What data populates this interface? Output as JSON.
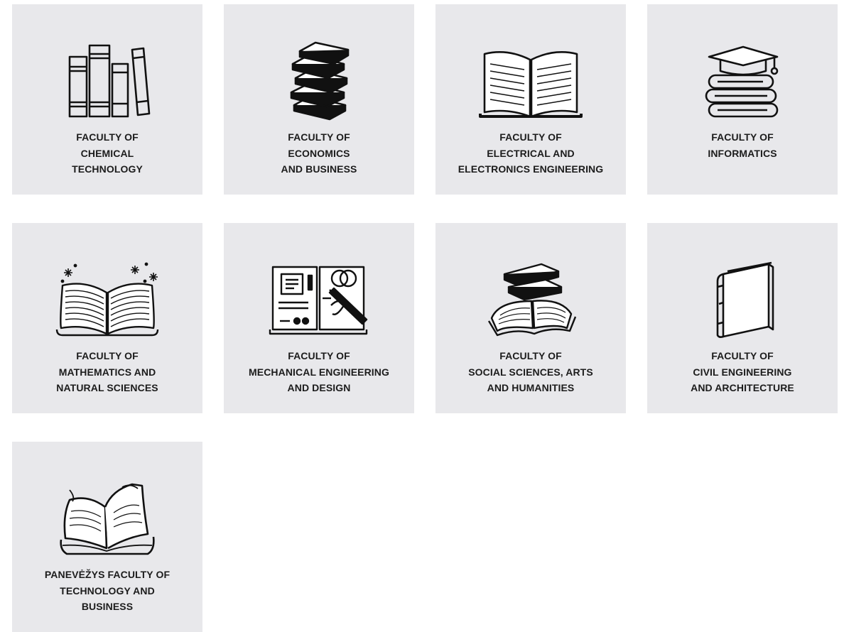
{
  "faculties": [
    {
      "label": "FACULTY OF\nCHEMICAL\nTECHNOLOGY",
      "icon": "books-row-icon"
    },
    {
      "label": "FACULTY OF\nECONOMICS\nAND BUSINESS",
      "icon": "book-stack-icon"
    },
    {
      "label": "FACULTY OF\nELECTRICAL AND\nELECTRONICS ENGINEERING",
      "icon": "open-book-icon"
    },
    {
      "label": "FACULTY OF\nINFORMATICS",
      "icon": "graduation-cap-books-icon"
    },
    {
      "label": "FACULTY OF\nMATHEMATICS AND\nNATURAL SCIENCES",
      "icon": "sparkle-open-book-icon"
    },
    {
      "label": "FACULTY OF\nMECHANICAL ENGINEERING\nAND DESIGN",
      "icon": "notebook-pen-icon"
    },
    {
      "label": "FACULTY OF\nSOCIAL SCIENCES, ARTS\nAND HUMANITIES",
      "icon": "books-and-open-book-icon"
    },
    {
      "label": "FACULTY OF\nCIVIL ENGINEERING\nAND ARCHITECTURE",
      "icon": "closed-book-icon"
    },
    {
      "label": "PANEVĖŽYS FACULTY OF\nTECHNOLOGY AND\nBUSINESS",
      "icon": "old-open-book-icon"
    }
  ],
  "colors": {
    "card_background": "#e8e8eb",
    "text": "#1c1c1c",
    "icon_stroke": "#111111"
  }
}
